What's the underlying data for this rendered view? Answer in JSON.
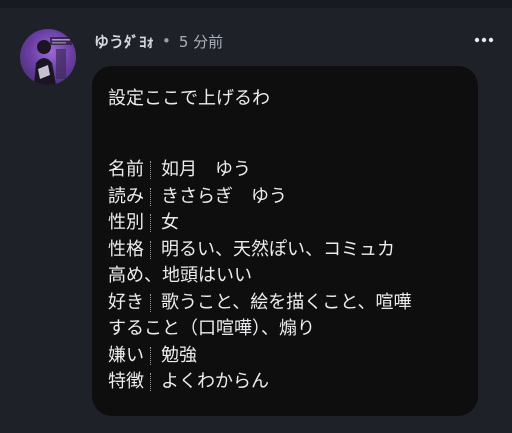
{
  "post": {
    "author": "ゆうﾀﾞﾖｫ",
    "separator": "•",
    "time": "5 分前",
    "intro": "設定ここで上げるわ",
    "profile": [
      {
        "key": "名前",
        "value": "如月　ゆう"
      },
      {
        "key": "読み",
        "value": "きさらぎ　ゆう"
      },
      {
        "key": "性別",
        "value": "女"
      },
      {
        "key": "性格",
        "value": "明るい、天然ぽい、コミュカ"
      },
      {
        "key": "",
        "value": "高め、地頭はいい"
      },
      {
        "key": "好き",
        "value": "歌うこと、絵を描くこと、喧嘩"
      },
      {
        "key": "",
        "value": "すること（口喧嘩）、煽り"
      },
      {
        "key": "嫌い",
        "value": "勉強"
      },
      {
        "key": "特徴",
        "value": "よくわからん"
      }
    ]
  },
  "icons": {
    "more": "more-horizontal-icon",
    "avatar": "avatar-image"
  },
  "colors": {
    "background": "#1e2128",
    "bubble": "#0e0e0f",
    "text": "#ececee",
    "meta": "#aab0ba",
    "avatar_accent": "#8a5cc8"
  }
}
